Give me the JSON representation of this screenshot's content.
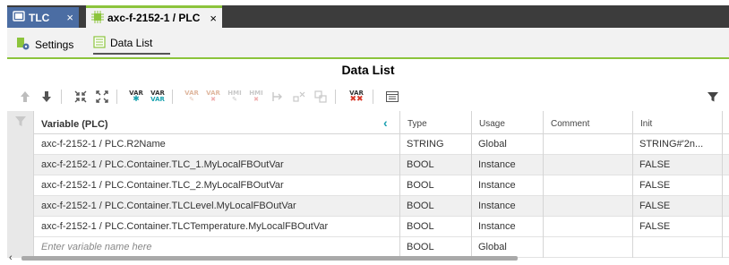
{
  "tabs": [
    {
      "label": "TLC",
      "close": "×"
    },
    {
      "label": "axc-f-2152-1 / PLC",
      "close": "×"
    }
  ],
  "subtabs": [
    {
      "label": "Settings"
    },
    {
      "label": "Data List"
    }
  ],
  "page_title": "Data List",
  "toolbar": {
    "var_label": "VAR",
    "hmi_label": "HMI"
  },
  "grid": {
    "headers": {
      "variable": "Variable (PLC)",
      "type": "Type",
      "usage": "Usage",
      "comment": "Comment",
      "init": "Init"
    },
    "collapse_glyph": "‹",
    "rows": [
      {
        "variable": "axc-f-2152-1 / PLC.R2Name",
        "type": "STRING",
        "usage": "Global",
        "comment": "",
        "init": "STRING#'2n..."
      },
      {
        "variable": "axc-f-2152-1 / PLC.Container.TLC_1.MyLocalFBOutVar",
        "type": "BOOL",
        "usage": "Instance",
        "comment": "",
        "init": "FALSE"
      },
      {
        "variable": "axc-f-2152-1 / PLC.Container.TLC_2.MyLocalFBOutVar",
        "type": "BOOL",
        "usage": "Instance",
        "comment": "",
        "init": "FALSE"
      },
      {
        "variable": "axc-f-2152-1 / PLC.Container.TLCLevel.MyLocalFBOutVar",
        "type": "BOOL",
        "usage": "Instance",
        "comment": "",
        "init": "FALSE"
      },
      {
        "variable": "axc-f-2152-1 / PLC.Container.TLCTemperature.MyLocalFBOutVar",
        "type": "BOOL",
        "usage": "Instance",
        "comment": "",
        "init": "FALSE"
      }
    ],
    "new_row": {
      "placeholder": "Enter variable name here",
      "type": "BOOL",
      "usage": "Global"
    }
  },
  "colors": {
    "accent_green": "#8cc43c",
    "tab_active_blue": "#4b6da3",
    "tabbar_dark": "#3c3c3c"
  }
}
